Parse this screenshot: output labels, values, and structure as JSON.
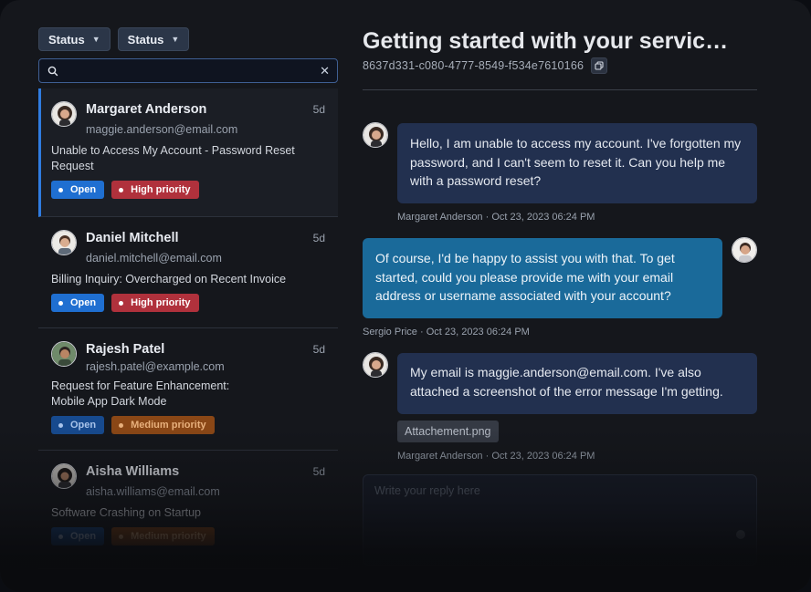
{
  "filters": [
    {
      "label": "Status"
    },
    {
      "label": "Status"
    }
  ],
  "search": {
    "value": "",
    "placeholder": ""
  },
  "tickets": [
    {
      "name": "Margaret Anderson",
      "email": "maggie.anderson@email.com",
      "age": "5d",
      "subject": "Unable to Access My Account - Password Reset Request",
      "status": "Open",
      "priority": "High priority"
    },
    {
      "name": "Daniel Mitchell",
      "email": "daniel.mitchell@email.com",
      "age": "5d",
      "subject": "Billing Inquiry: Overcharged on Recent Invoice",
      "status": "Open",
      "priority": "High priority"
    },
    {
      "name": "Rajesh Patel",
      "email": "rajesh.patel@example.com",
      "age": "5d",
      "subject": "Request for Feature Enhancement: Mobile App Dark Mode",
      "status": "Open",
      "priority": "Medium priority"
    },
    {
      "name": "Aisha Williams",
      "email": "aisha.williams@email.com",
      "age": "5d",
      "subject": "Software Crashing on Startup",
      "status": "Open",
      "priority": "Medium priority"
    }
  ],
  "conversation": {
    "title": "Getting started with your servic…",
    "ticket_id": "8637d331-c080-4777-8549-f534e7610166",
    "messages": [
      {
        "text": "Hello, I am unable to access my account. I've forgotten my password, and I can't seem to reset it. Can you help me with a password reset?",
        "meta": "Margaret Anderson · Oct 23, 2023 06:24 PM"
      },
      {
        "text": "Of course, I'd be happy to assist you with that. To get started, could you please provide me with your email address or username associated with your account?",
        "meta": "Sergio Price · Oct 23, 2023 06:24 PM"
      },
      {
        "text": "My email is maggie.anderson@email.com. I've also attached a screenshot of the error message I'm getting.",
        "meta": "Margaret Anderson · Oct 23, 2023 06:24 PM",
        "attachment": "Attachement.png"
      }
    ],
    "reply_placeholder": "Write your reply here"
  },
  "icons": {
    "filter_chevron": "chevron-down-icon",
    "search": "search-icon",
    "clear": "close-icon",
    "copy": "copy-icon"
  },
  "colors": {
    "accent": "#1f6fd1",
    "open_badge": "#1f6fd1",
    "high_priority": "#b0313c",
    "medium_priority": "#8a4716",
    "agent_bubble": "#1a6a9a",
    "customer_bubble": "#22304f"
  }
}
